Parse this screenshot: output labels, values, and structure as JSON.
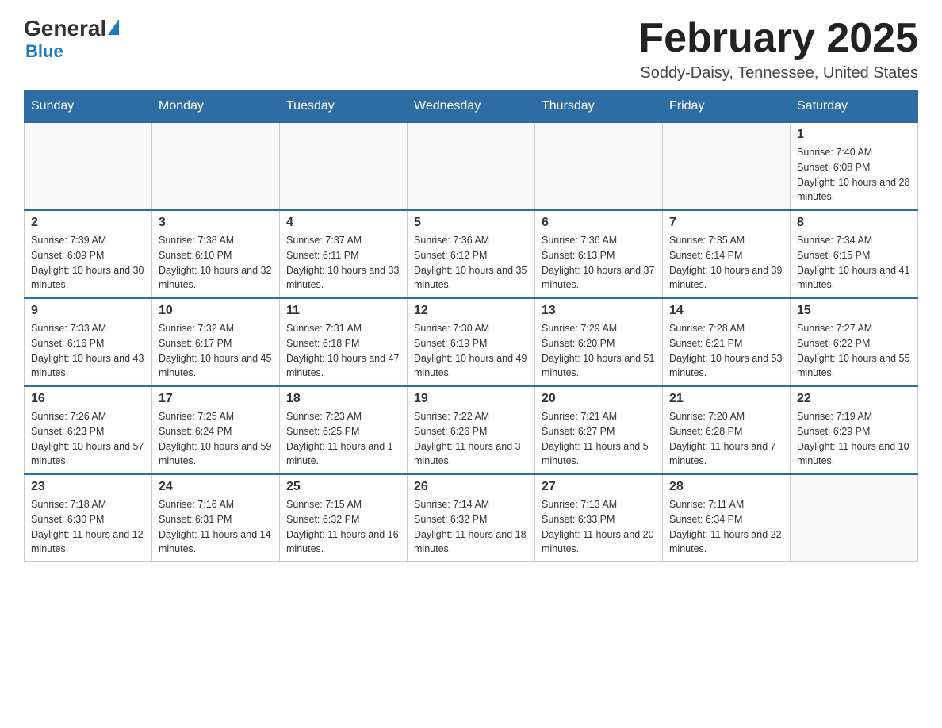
{
  "header": {
    "logo_general": "General",
    "logo_blue": "Blue",
    "month_title": "February 2025",
    "location": "Soddy-Daisy, Tennessee, United States"
  },
  "weekdays": [
    "Sunday",
    "Monday",
    "Tuesday",
    "Wednesday",
    "Thursday",
    "Friday",
    "Saturday"
  ],
  "weeks": [
    [
      {
        "day": "",
        "sunrise": "",
        "sunset": "",
        "daylight": ""
      },
      {
        "day": "",
        "sunrise": "",
        "sunset": "",
        "daylight": ""
      },
      {
        "day": "",
        "sunrise": "",
        "sunset": "",
        "daylight": ""
      },
      {
        "day": "",
        "sunrise": "",
        "sunset": "",
        "daylight": ""
      },
      {
        "day": "",
        "sunrise": "",
        "sunset": "",
        "daylight": ""
      },
      {
        "day": "",
        "sunrise": "",
        "sunset": "",
        "daylight": ""
      },
      {
        "day": "1",
        "sunrise": "Sunrise: 7:40 AM",
        "sunset": "Sunset: 6:08 PM",
        "daylight": "Daylight: 10 hours and 28 minutes."
      }
    ],
    [
      {
        "day": "2",
        "sunrise": "Sunrise: 7:39 AM",
        "sunset": "Sunset: 6:09 PM",
        "daylight": "Daylight: 10 hours and 30 minutes."
      },
      {
        "day": "3",
        "sunrise": "Sunrise: 7:38 AM",
        "sunset": "Sunset: 6:10 PM",
        "daylight": "Daylight: 10 hours and 32 minutes."
      },
      {
        "day": "4",
        "sunrise": "Sunrise: 7:37 AM",
        "sunset": "Sunset: 6:11 PM",
        "daylight": "Daylight: 10 hours and 33 minutes."
      },
      {
        "day": "5",
        "sunrise": "Sunrise: 7:36 AM",
        "sunset": "Sunset: 6:12 PM",
        "daylight": "Daylight: 10 hours and 35 minutes."
      },
      {
        "day": "6",
        "sunrise": "Sunrise: 7:36 AM",
        "sunset": "Sunset: 6:13 PM",
        "daylight": "Daylight: 10 hours and 37 minutes."
      },
      {
        "day": "7",
        "sunrise": "Sunrise: 7:35 AM",
        "sunset": "Sunset: 6:14 PM",
        "daylight": "Daylight: 10 hours and 39 minutes."
      },
      {
        "day": "8",
        "sunrise": "Sunrise: 7:34 AM",
        "sunset": "Sunset: 6:15 PM",
        "daylight": "Daylight: 10 hours and 41 minutes."
      }
    ],
    [
      {
        "day": "9",
        "sunrise": "Sunrise: 7:33 AM",
        "sunset": "Sunset: 6:16 PM",
        "daylight": "Daylight: 10 hours and 43 minutes."
      },
      {
        "day": "10",
        "sunrise": "Sunrise: 7:32 AM",
        "sunset": "Sunset: 6:17 PM",
        "daylight": "Daylight: 10 hours and 45 minutes."
      },
      {
        "day": "11",
        "sunrise": "Sunrise: 7:31 AM",
        "sunset": "Sunset: 6:18 PM",
        "daylight": "Daylight: 10 hours and 47 minutes."
      },
      {
        "day": "12",
        "sunrise": "Sunrise: 7:30 AM",
        "sunset": "Sunset: 6:19 PM",
        "daylight": "Daylight: 10 hours and 49 minutes."
      },
      {
        "day": "13",
        "sunrise": "Sunrise: 7:29 AM",
        "sunset": "Sunset: 6:20 PM",
        "daylight": "Daylight: 10 hours and 51 minutes."
      },
      {
        "day": "14",
        "sunrise": "Sunrise: 7:28 AM",
        "sunset": "Sunset: 6:21 PM",
        "daylight": "Daylight: 10 hours and 53 minutes."
      },
      {
        "day": "15",
        "sunrise": "Sunrise: 7:27 AM",
        "sunset": "Sunset: 6:22 PM",
        "daylight": "Daylight: 10 hours and 55 minutes."
      }
    ],
    [
      {
        "day": "16",
        "sunrise": "Sunrise: 7:26 AM",
        "sunset": "Sunset: 6:23 PM",
        "daylight": "Daylight: 10 hours and 57 minutes."
      },
      {
        "day": "17",
        "sunrise": "Sunrise: 7:25 AM",
        "sunset": "Sunset: 6:24 PM",
        "daylight": "Daylight: 10 hours and 59 minutes."
      },
      {
        "day": "18",
        "sunrise": "Sunrise: 7:23 AM",
        "sunset": "Sunset: 6:25 PM",
        "daylight": "Daylight: 11 hours and 1 minute."
      },
      {
        "day": "19",
        "sunrise": "Sunrise: 7:22 AM",
        "sunset": "Sunset: 6:26 PM",
        "daylight": "Daylight: 11 hours and 3 minutes."
      },
      {
        "day": "20",
        "sunrise": "Sunrise: 7:21 AM",
        "sunset": "Sunset: 6:27 PM",
        "daylight": "Daylight: 11 hours and 5 minutes."
      },
      {
        "day": "21",
        "sunrise": "Sunrise: 7:20 AM",
        "sunset": "Sunset: 6:28 PM",
        "daylight": "Daylight: 11 hours and 7 minutes."
      },
      {
        "day": "22",
        "sunrise": "Sunrise: 7:19 AM",
        "sunset": "Sunset: 6:29 PM",
        "daylight": "Daylight: 11 hours and 10 minutes."
      }
    ],
    [
      {
        "day": "23",
        "sunrise": "Sunrise: 7:18 AM",
        "sunset": "Sunset: 6:30 PM",
        "daylight": "Daylight: 11 hours and 12 minutes."
      },
      {
        "day": "24",
        "sunrise": "Sunrise: 7:16 AM",
        "sunset": "Sunset: 6:31 PM",
        "daylight": "Daylight: 11 hours and 14 minutes."
      },
      {
        "day": "25",
        "sunrise": "Sunrise: 7:15 AM",
        "sunset": "Sunset: 6:32 PM",
        "daylight": "Daylight: 11 hours and 16 minutes."
      },
      {
        "day": "26",
        "sunrise": "Sunrise: 7:14 AM",
        "sunset": "Sunset: 6:32 PM",
        "daylight": "Daylight: 11 hours and 18 minutes."
      },
      {
        "day": "27",
        "sunrise": "Sunrise: 7:13 AM",
        "sunset": "Sunset: 6:33 PM",
        "daylight": "Daylight: 11 hours and 20 minutes."
      },
      {
        "day": "28",
        "sunrise": "Sunrise: 7:11 AM",
        "sunset": "Sunset: 6:34 PM",
        "daylight": "Daylight: 11 hours and 22 minutes."
      },
      {
        "day": "",
        "sunrise": "",
        "sunset": "",
        "daylight": ""
      }
    ]
  ]
}
